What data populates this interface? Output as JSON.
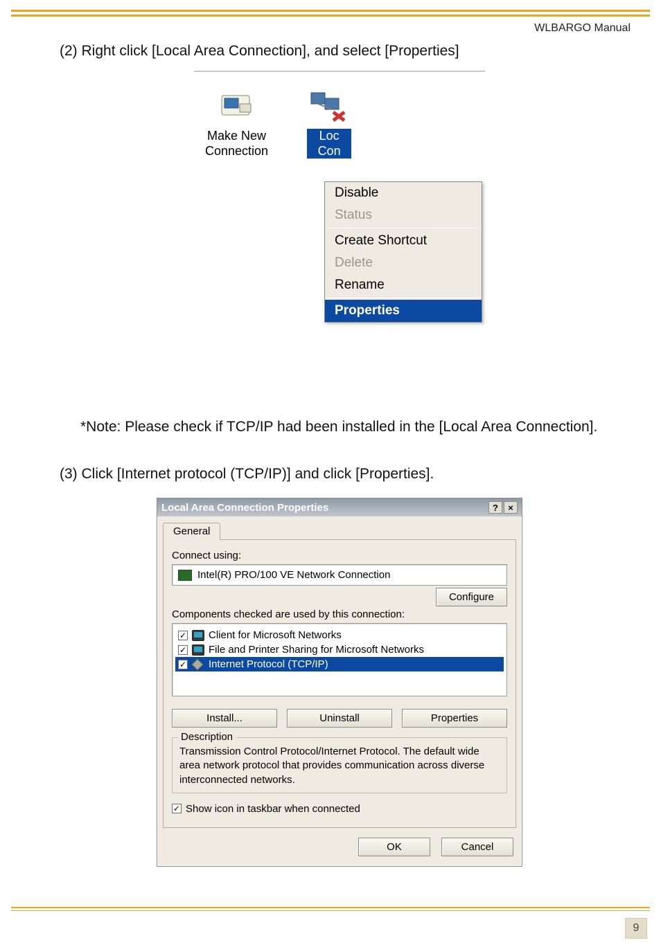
{
  "header": {
    "manual_title": "WLBARGO Manual"
  },
  "instructions": {
    "step2": "(2) Right click [Local Area Connection], and select [Properties]",
    "note": "*Note: Please check if TCP/IP had been installed in the [Local Area Connection].",
    "step3": "(3) Click [Internet protocol (TCP/IP)] and click [Properties]."
  },
  "context_menu": {
    "icons": {
      "make_new_connection": "Make New\nConnection",
      "local_area_connection_top": "Loc",
      "local_area_connection_side": "Con"
    },
    "items": {
      "disable": "Disable",
      "status": "Status",
      "create_shortcut": "Create Shortcut",
      "delete": "Delete",
      "rename": "Rename",
      "properties": "Properties"
    }
  },
  "dialog": {
    "title": "Local Area Connection Properties",
    "help_btn": "?",
    "close_btn": "×",
    "tab_general": "General",
    "connect_using_label": "Connect using:",
    "adapter_name": "Intel(R) PRO/100 VE Network Connection",
    "configure_btn": "Configure",
    "components_label": "Components checked are used by this connection:",
    "components": {
      "client": "Client for Microsoft Networks",
      "file_printer": "File and Printer Sharing for Microsoft Networks",
      "tcpip": "Internet Protocol (TCP/IP)"
    },
    "install_btn": "Install...",
    "uninstall_btn": "Uninstall",
    "properties_btn": "Properties",
    "description_legend": "Description",
    "description_text": "Transmission Control Protocol/Internet Protocol. The default wide area network protocol that provides communication across diverse interconnected networks.",
    "show_icon": "Show icon in taskbar when connected",
    "ok_btn": "OK",
    "cancel_btn": "Cancel"
  },
  "footer": {
    "page_number": "9"
  }
}
